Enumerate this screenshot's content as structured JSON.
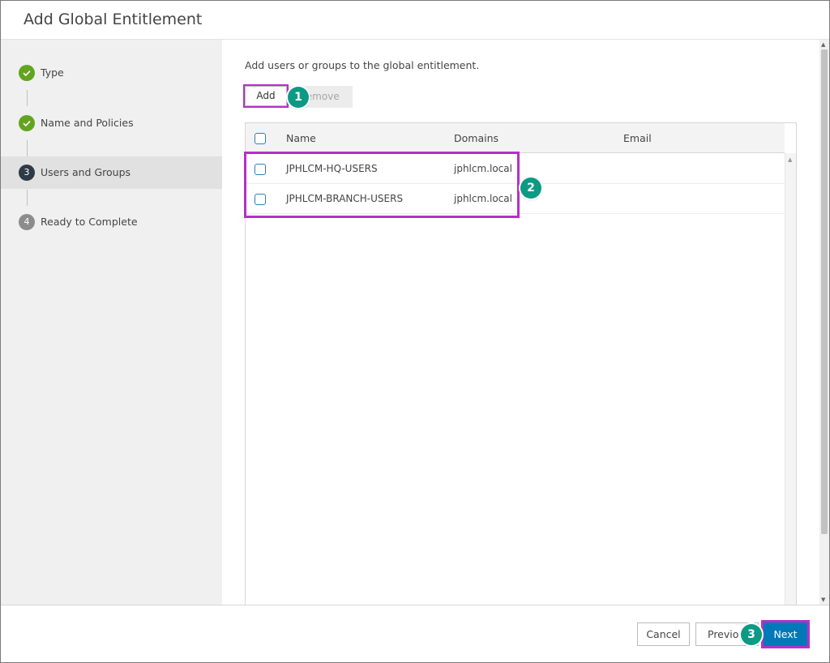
{
  "dialog": {
    "title": "Add Global Entitlement"
  },
  "steps": [
    {
      "number": "",
      "label": "Type",
      "state": "done"
    },
    {
      "number": "",
      "label": "Name and Policies",
      "state": "done"
    },
    {
      "number": "3",
      "label": "Users and Groups",
      "state": "current"
    },
    {
      "number": "4",
      "label": "Ready to Complete",
      "state": "pending"
    }
  ],
  "main": {
    "intro": "Add users or groups to the global entitlement.",
    "add_label": "Add",
    "remove_label": "Remove",
    "grid": {
      "columns": [
        "Name",
        "Domains",
        "Email"
      ],
      "rows": [
        {
          "name": "JPHLCM-HQ-USERS",
          "domain": "jphlcm.local",
          "email": ""
        },
        {
          "name": "JPHLCM-BRANCH-USERS",
          "domain": "jphlcm.local",
          "email": ""
        }
      ]
    }
  },
  "footer": {
    "cancel_label": "Cancel",
    "previous_label": "Previous",
    "next_label": "Next"
  },
  "annotations": {
    "badge1": "1",
    "badge2": "2",
    "badge3": "3"
  },
  "colors": {
    "accent": "#0079b8",
    "done": "#62a420",
    "highlight": "#b530c8",
    "badge": "#0c9a84"
  },
  "icons": {
    "done_step": "check-icon"
  }
}
